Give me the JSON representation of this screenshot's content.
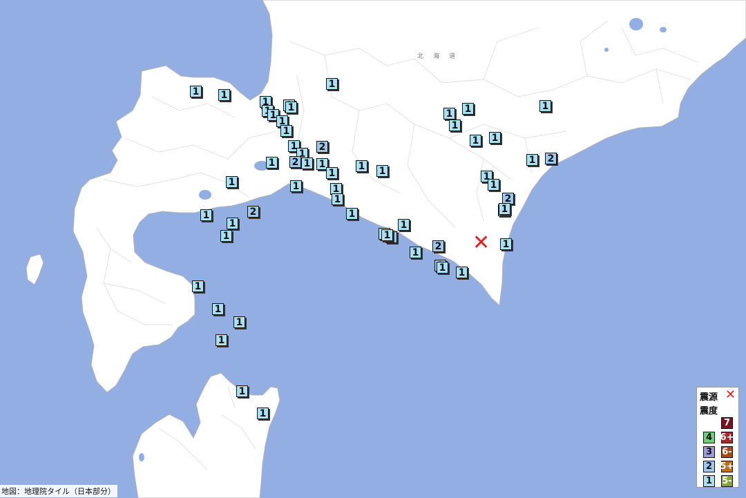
{
  "map": {
    "region_label": "北海道",
    "land_color": "#ffffff",
    "sea_color": "#92aee3",
    "epicenter": {
      "symbol": "✕",
      "color": "#e3201e"
    },
    "stations": [
      {
        "i": "1"
      },
      {
        "i": "1"
      },
      {
        "i": "1"
      },
      {
        "i": "1"
      },
      {
        "i": "1"
      },
      {
        "i": "1"
      },
      {
        "i": "1"
      },
      {
        "i": "1"
      },
      {
        "i": "1"
      },
      {
        "i": "1"
      },
      {
        "i": "1"
      },
      {
        "i": "2"
      },
      {
        "i": "2"
      },
      {
        "i": "1"
      },
      {
        "i": "1"
      },
      {
        "i": "1"
      },
      {
        "i": "1"
      },
      {
        "i": "1"
      },
      {
        "i": "1"
      },
      {
        "i": "1"
      },
      {
        "i": "1"
      },
      {
        "i": "1"
      },
      {
        "i": "1"
      },
      {
        "i": "1"
      },
      {
        "i": "1"
      },
      {
        "i": "1"
      },
      {
        "i": "1"
      },
      {
        "i": "1"
      },
      {
        "i": "1"
      },
      {
        "i": "1"
      },
      {
        "i": "2"
      },
      {
        "i": "1"
      },
      {
        "i": "1"
      },
      {
        "i": "2"
      },
      {
        "i": "1"
      },
      {
        "i": "2"
      },
      {
        "i": "2"
      },
      {
        "i": "1"
      },
      {
        "i": "1"
      },
      {
        "i": "1"
      },
      {
        "i": "1"
      },
      {
        "i": "1"
      },
      {
        "i": "1"
      },
      {
        "i": "1"
      },
      {
        "i": "1"
      },
      {
        "i": "1"
      },
      {
        "i": "1"
      },
      {
        "i": "1"
      },
      {
        "i": "1"
      },
      {
        "i": "2"
      },
      {
        "i": "1"
      },
      {
        "i": "1"
      },
      {
        "i": "2"
      },
      {
        "i": "1"
      },
      {
        "i": "1"
      },
      {
        "i": "1"
      },
      {
        "i": "1"
      },
      {
        "i": "1"
      }
    ]
  },
  "legend": {
    "epicenter_label": "震源",
    "intensity_label": "震度",
    "items": [
      {
        "label": "7",
        "bg": "#7a0f23",
        "fg": "#ffffff"
      },
      {
        "label": "6+",
        "bg": "#a5282f",
        "fg": "#ffffff"
      },
      {
        "label": "6-",
        "bg": "#a64a19",
        "fg": "#ffffff"
      },
      {
        "label": "5+",
        "bg": "#b9711f",
        "fg": "#ffffff"
      },
      {
        "label": "5-",
        "bg": "#8aa33a",
        "fg": "#ffffff"
      },
      {
        "label": "4",
        "bg": "#6ed17a",
        "fg": "#111111"
      },
      {
        "label": "3",
        "bg": "#9e9bd8",
        "fg": "#111111"
      },
      {
        "label": "2",
        "bg": "#9fc8ee",
        "fg": "#111111"
      },
      {
        "label": "1",
        "bg": "#a7e1f3",
        "fg": "#111111"
      }
    ]
  },
  "intensity_colors": {
    "1": "#a7e1f3",
    "2": "#9fc8ee"
  },
  "credit": "地図：地理院タイル（日本部分）"
}
